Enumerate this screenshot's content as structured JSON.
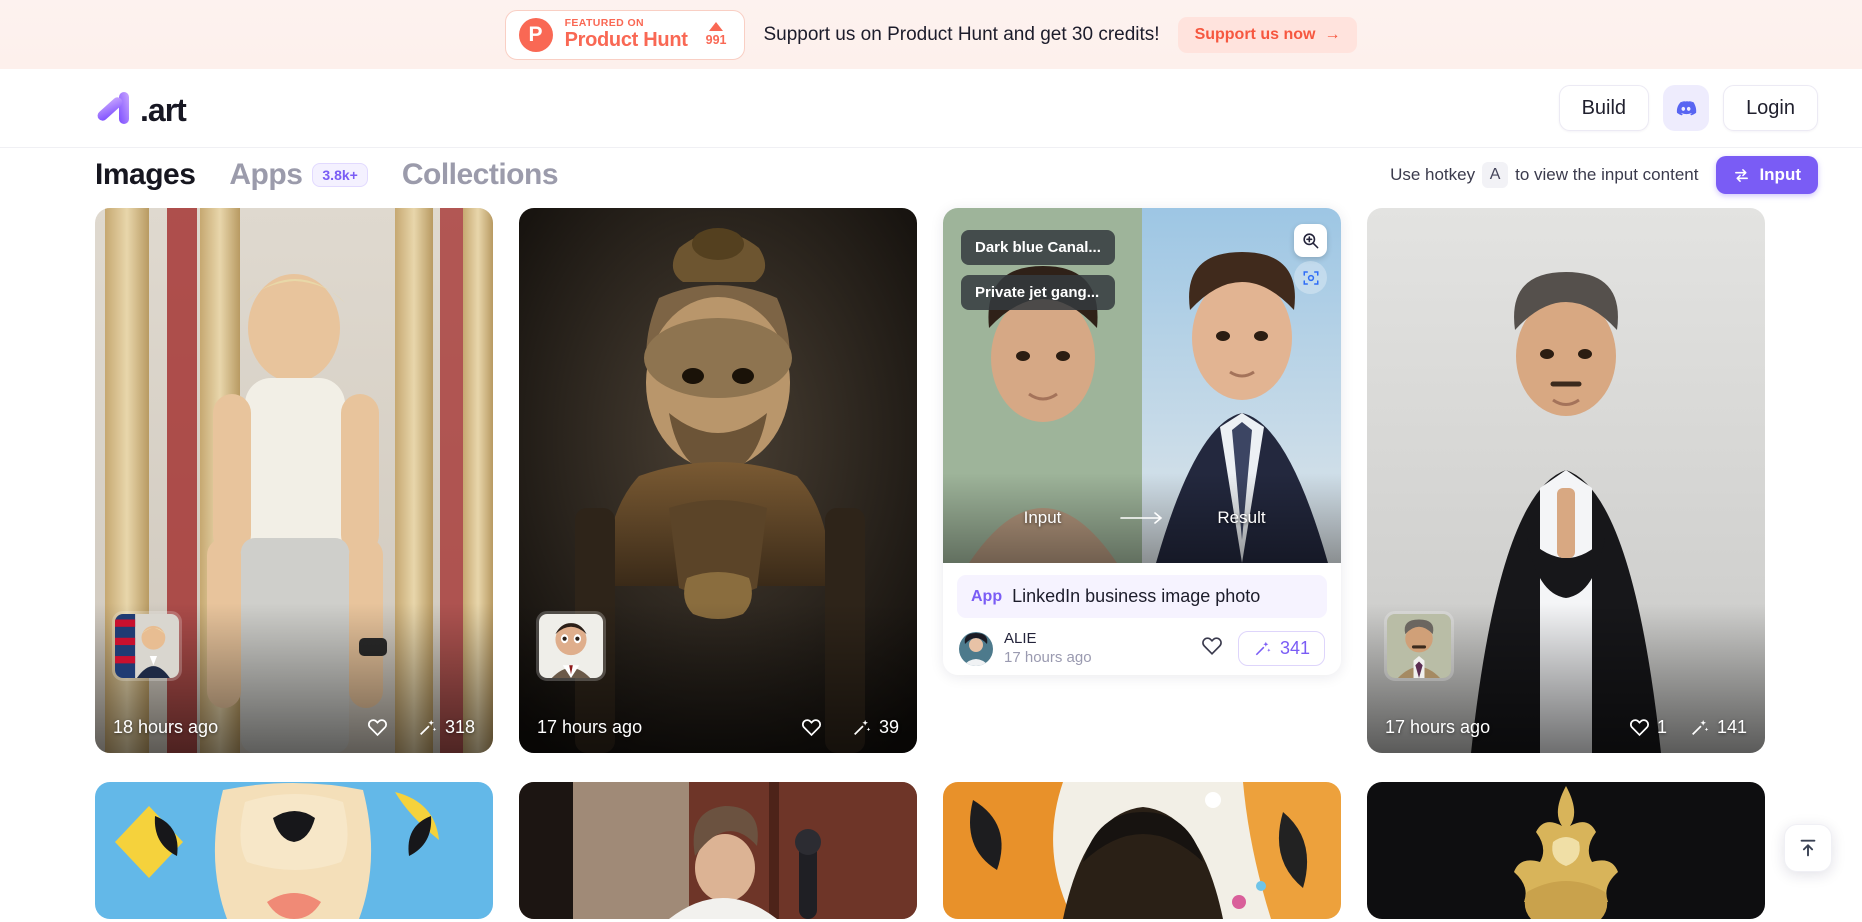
{
  "banner": {
    "featured_label": "FEATURED ON",
    "product_name": "Product Hunt",
    "upvotes": "991",
    "message": "Support us on Product Hunt and get 30 credits!",
    "cta_label": "Support us now",
    "cta_arrow": "→",
    "ph_logo_letter": "P",
    "background": "#fdf1ee",
    "accent": "#f96854"
  },
  "header": {
    "logo_word": ".art",
    "build_label": "Build",
    "login_label": "Login",
    "discord_icon": "discord-icon",
    "brand_purple": "#7a5cf5"
  },
  "tabs": [
    {
      "label": "Images",
      "active": true,
      "badge": ""
    },
    {
      "label": "Apps",
      "active": false,
      "badge": "3.8k+"
    },
    {
      "label": "Collections",
      "active": false,
      "badge": ""
    }
  ],
  "toolbar": {
    "hotkey_prefix": "Use hotkey",
    "hotkey_key": "A",
    "hotkey_suffix": "to view the input content",
    "input_button_label": "Input",
    "input_button_icon": "swap-icon"
  },
  "gallery": {
    "cards": [
      {
        "kind": "photo",
        "time": "18 hours ago",
        "likes": "",
        "generations": "318",
        "like_icon": "heart-icon",
        "generate_icon": "magic-wand-icon"
      },
      {
        "kind": "photo",
        "time": "17 hours ago",
        "likes": "",
        "generations": "39",
        "like_icon": "heart-icon",
        "generate_icon": "magic-wand-icon"
      },
      {
        "kind": "app",
        "tags": [
          "Dark blue Canal...",
          "Private jet gang..."
        ],
        "input_label": "Input",
        "result_label": "Result",
        "app_tag_word": "App",
        "app_name": "LinkedIn business image photo",
        "author": "ALIE",
        "time": "17 hours ago",
        "likes": "",
        "generations": "341",
        "like_icon": "heart-icon",
        "generate_icon": "magic-wand-icon",
        "zoom_icon": "magnifier-plus-icon",
        "scan_icon": "scan-focus-icon"
      },
      {
        "kind": "photo",
        "time": "17 hours ago",
        "likes": "1",
        "generations": "141",
        "like_icon": "heart-icon",
        "generate_icon": "magic-wand-icon"
      }
    ]
  },
  "scroll_top": {
    "icon": "scroll-to-top-icon"
  }
}
